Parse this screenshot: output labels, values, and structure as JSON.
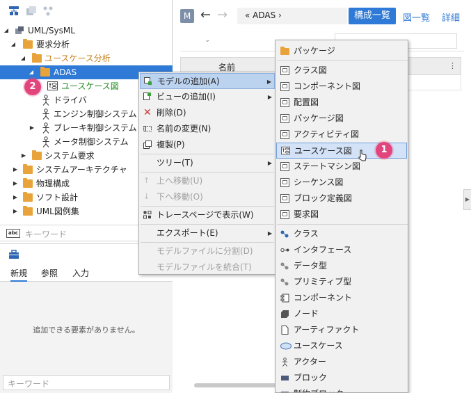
{
  "tree": {
    "root": "UML/SysML",
    "items": [
      {
        "label": "要求分析"
      },
      {
        "label": "ユースケース分析"
      },
      {
        "label": "ADAS"
      },
      {
        "label": "ユースケース図"
      },
      {
        "label": "ドライバ"
      },
      {
        "label": "エンジン制御システム"
      },
      {
        "label": "ブレーキ制御システム"
      },
      {
        "label": "メータ制御システム"
      },
      {
        "label": "システム要求"
      },
      {
        "label": "システムアーキテクチャ"
      },
      {
        "label": "物理構成"
      },
      {
        "label": "ソフト設計"
      },
      {
        "label": "UML図例集"
      }
    ]
  },
  "keyword_placeholder": "キーワード",
  "keyword_abc": "abc",
  "lower_tabs": [
    "新規",
    "参照",
    "入力"
  ],
  "empty_message": "追加できる要素がありません。",
  "keyword_placeholder2": "キーワード",
  "topbar": {
    "m_label": "M",
    "back": "←",
    "forward": "→",
    "breadcrumb": "« ADAS ›",
    "struct_btn": "構成一覧",
    "diagram_btn": "図一覧",
    "detail_btn": "詳細"
  },
  "table": {
    "name_header": "名前"
  },
  "context_menu": {
    "items": [
      {
        "label": "モデルの追加(A)",
        "submenu": true,
        "highlight": true
      },
      {
        "label": "ビューの追加(I)",
        "submenu": true
      },
      {
        "label": "削除(D)"
      },
      {
        "label": "名前の変更(N)"
      },
      {
        "label": "複製(P)"
      },
      {
        "label": "ツリー(T)",
        "submenu": true
      },
      {
        "label": "上へ移動(U)",
        "disabled": true
      },
      {
        "label": "下へ移動(O)",
        "disabled": true
      },
      {
        "label": "トレースページで表示(W)"
      },
      {
        "label": "エクスポート(E)",
        "submenu": true
      },
      {
        "label": "モデルファイルに分割(D)",
        "disabled": true
      },
      {
        "label": "モデルファイルを統合(T)",
        "disabled": true
      }
    ]
  },
  "submenu": {
    "items": [
      "パッケージ",
      "クラス図",
      "コンポーネント図",
      "配置図",
      "パッケージ図",
      "アクティビティ図",
      "ユースケース図",
      "ステートマシン図",
      "シーケンス図",
      "ブロック定義図",
      "要求図",
      "クラス",
      "インタフェース",
      "データ型",
      "プリミティブ型",
      "コンポーネント",
      "ノード",
      "アーティファクト",
      "ユースケース",
      "アクター",
      "ブロック",
      "制約ブロック"
    ]
  },
  "badges": {
    "one": "1",
    "two": "2"
  },
  "colors": {
    "accent": "#2f7ad6",
    "badge": "#e2457c",
    "folder": "#e8a33a"
  }
}
